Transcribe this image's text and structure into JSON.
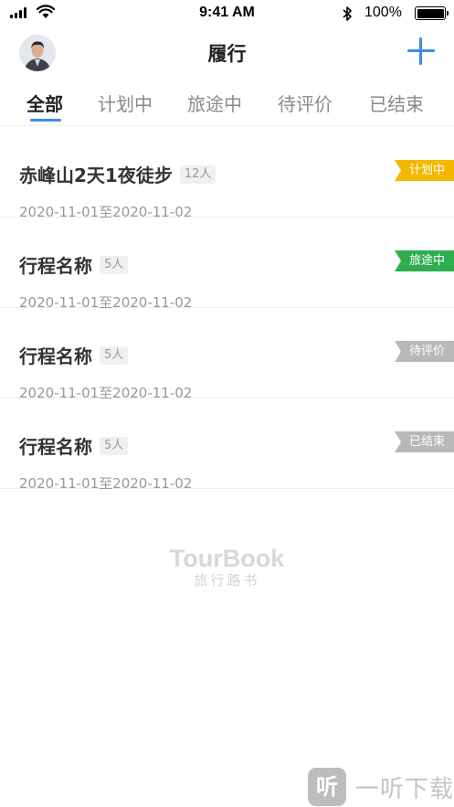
{
  "status_bar": {
    "time": "9:41 AM",
    "battery_percent": "100%",
    "battery_level": 1.0,
    "icons": [
      "cellular-signal-icon",
      "wifi-icon",
      "bluetooth-icon",
      "battery-icon"
    ]
  },
  "header": {
    "title": "履行",
    "avatar_icon": "avatar",
    "add_icon": "plus-icon",
    "accent_color": "#3a8ee6"
  },
  "tabs": [
    {
      "label": "全部",
      "active": true
    },
    {
      "label": "计划中",
      "active": false
    },
    {
      "label": "旅途中",
      "active": false
    },
    {
      "label": "待评价",
      "active": false
    },
    {
      "label": "已结束",
      "active": false
    }
  ],
  "trips": [
    {
      "name": "赤峰山2天1夜徒步",
      "members": "12人",
      "date_range": "2020-11-01至2020-11-02",
      "status": "计划中",
      "status_color": "#f5b800"
    },
    {
      "name": "行程名称",
      "members": "5人",
      "date_range": "2020-11-01至2020-11-02",
      "status": "旅途中",
      "status_color": "#2fae4f"
    },
    {
      "name": "行程名称",
      "members": "5人",
      "date_range": "2020-11-01至2020-11-02",
      "status": "待评价",
      "status_color": "#b8b8b8"
    },
    {
      "name": "行程名称",
      "members": "5人",
      "date_range": "2020-11-01至2020-11-02",
      "status": "已结束",
      "status_color": "#b8b8b8"
    }
  ],
  "brand": {
    "name": "TourBook",
    "subtitle": "旅行路书"
  },
  "watermark": {
    "icon_char": "听",
    "text": "一听下载"
  }
}
